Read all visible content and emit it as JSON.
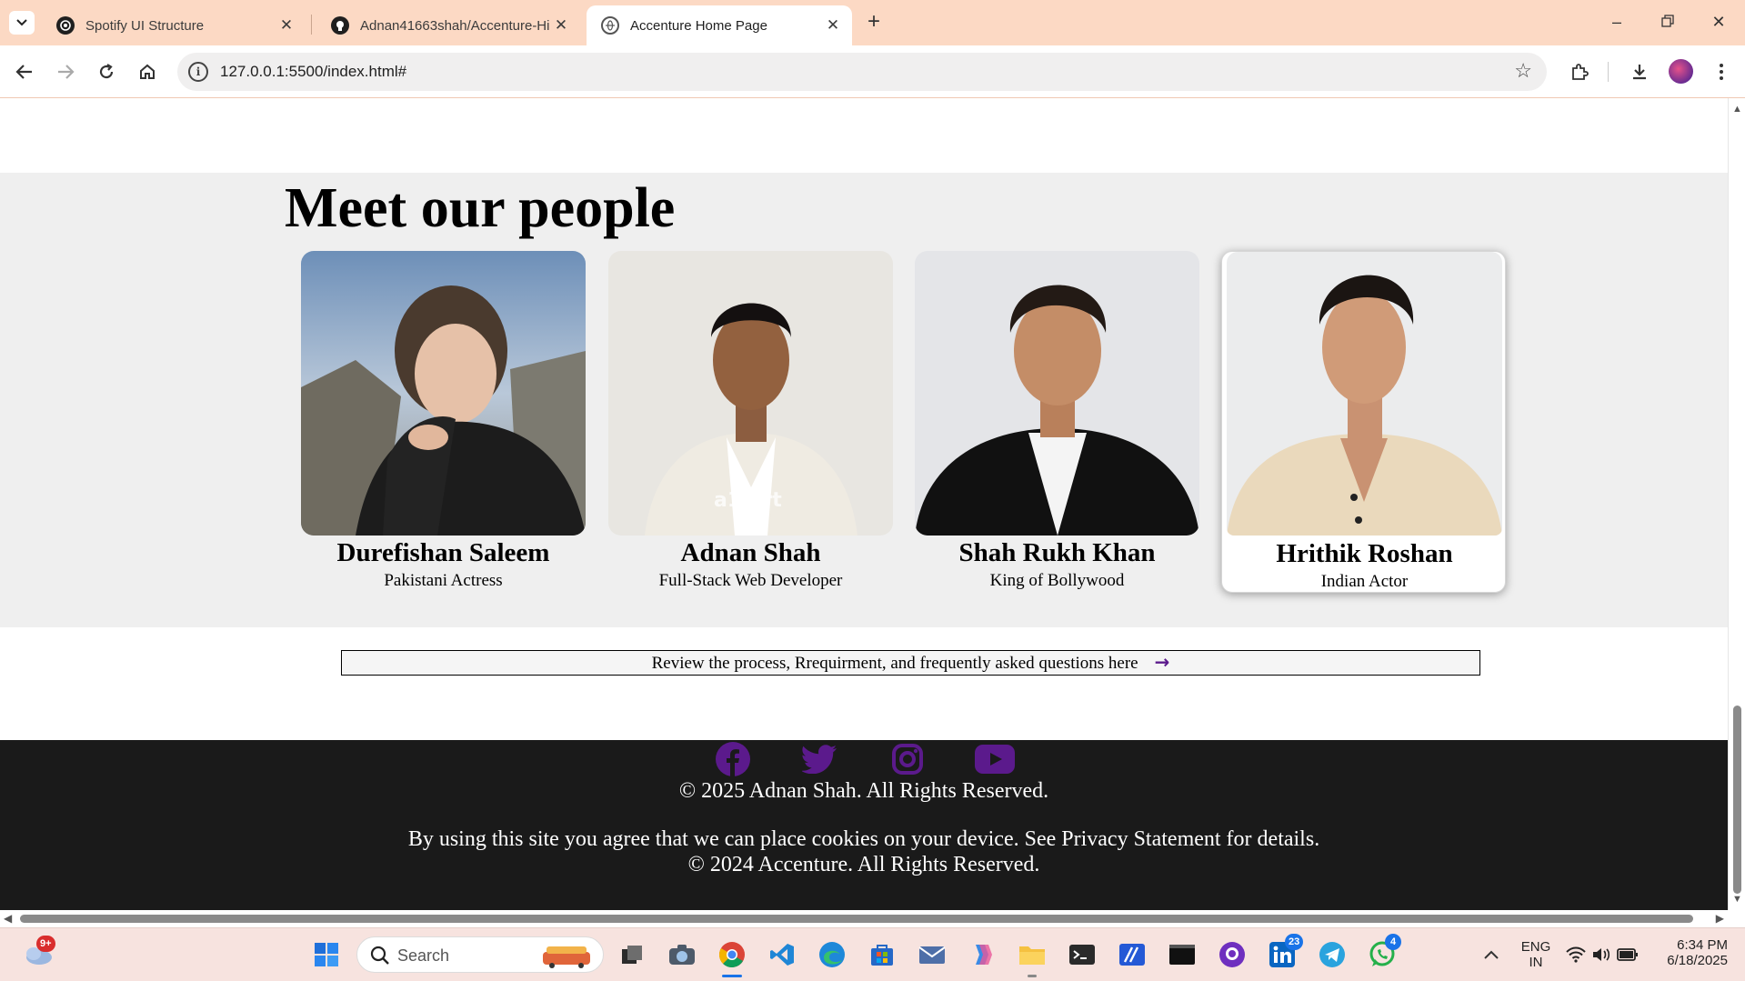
{
  "browser": {
    "tabs": [
      {
        "title": "Spotify UI Structure",
        "active": false
      },
      {
        "title": "Adnan41663shah/Accenture-Hi",
        "active": false
      },
      {
        "title": "Accenture Home Page",
        "active": true
      }
    ],
    "url": "127.0.0.1:5500/index.html#"
  },
  "page": {
    "heading": "Meet our people",
    "people": [
      {
        "name": "Durefishan Saleem",
        "role": "Pakistani Actress",
        "hovered": false
      },
      {
        "name": "Adnan Shah",
        "role": "Full-Stack Web Developer",
        "hovered": false,
        "watermark": "a1.art"
      },
      {
        "name": "Shah Rukh Khan",
        "role": "King of Bollywood",
        "hovered": false
      },
      {
        "name": "Hrithik Roshan",
        "role": "Indian Actor",
        "hovered": true
      }
    ],
    "faq_link": "Review the process, Rrequirment, and frequently asked questions here",
    "footer": {
      "social": [
        "facebook-icon",
        "twitter-icon",
        "instagram-icon",
        "youtube-icon"
      ],
      "social_color": "#5b1a8c",
      "copyright_1": "© 2025 Adnan Shah. All Rights Reserved.",
      "cookie_notice": "By using this site you agree that we can place cookies on your device. See Privacy Statement for details.",
      "copyright_2": "© 2024 Accenture. All Rights Reserved."
    }
  },
  "taskbar": {
    "search_placeholder": "Search",
    "weather_badge": "9+",
    "linkedin_badge": "23",
    "whatsapp_badge": "4",
    "language": "ENG",
    "region": "IN",
    "time": "6:34 PM",
    "date": "6/18/2025"
  }
}
